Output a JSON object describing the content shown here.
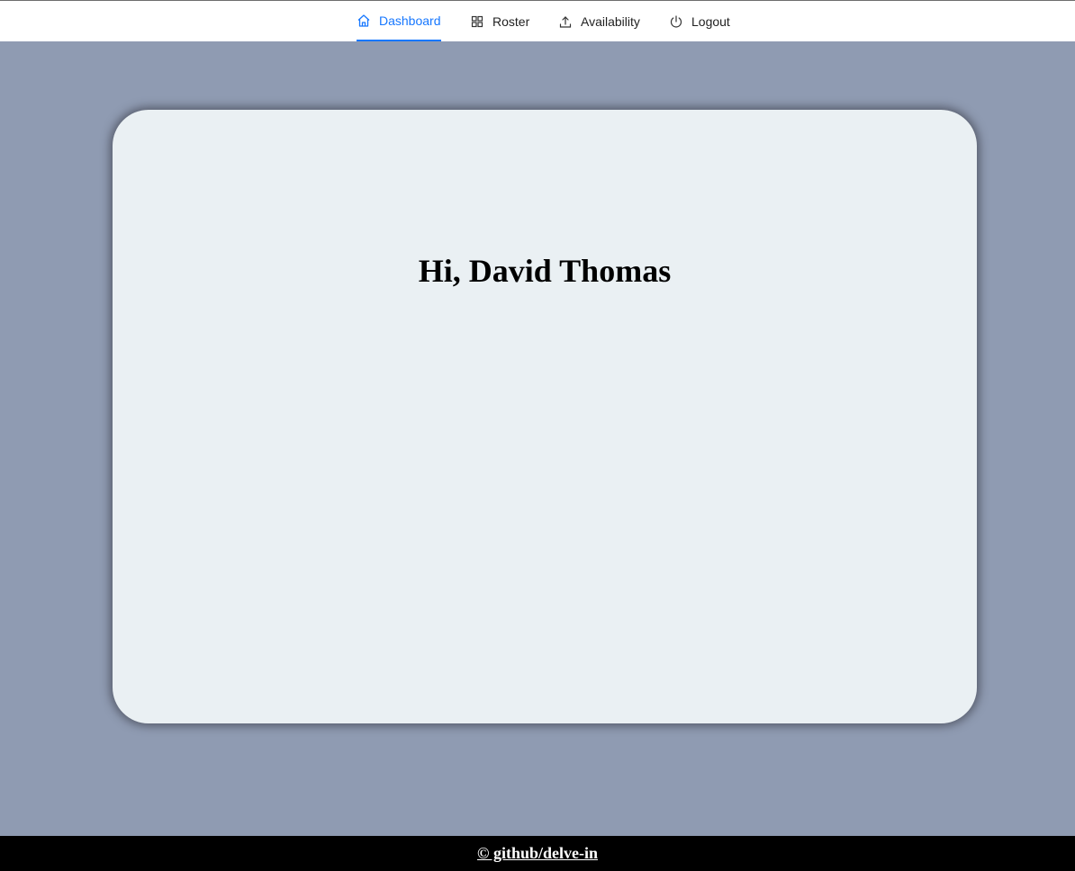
{
  "nav": {
    "items": [
      {
        "label": "Dashboard",
        "icon": "home-icon",
        "active": true
      },
      {
        "label": "Roster",
        "icon": "grid-icon",
        "active": false
      },
      {
        "label": "Availability",
        "icon": "upload-icon",
        "active": false
      },
      {
        "label": "Logout",
        "icon": "power-icon",
        "active": false
      }
    ]
  },
  "main": {
    "greeting": "Hi, David Thomas"
  },
  "footer": {
    "text": "© github/delve-in"
  },
  "colors": {
    "accent": "#1677ff",
    "background": "#8f9bb2",
    "card": "#eaf0f3",
    "footer": "#000000"
  }
}
